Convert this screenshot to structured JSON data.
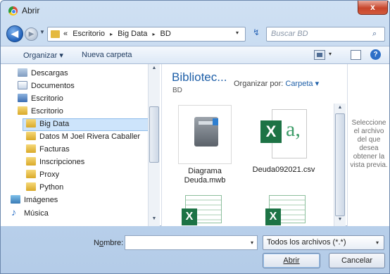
{
  "window": {
    "title": "Abrir",
    "close_glyph": "x"
  },
  "nav": {
    "back_glyph": "◀",
    "forward_glyph": "▶",
    "history_glyph": "▼",
    "breadcrumb_lead": "«",
    "breadcrumb_sep": "▸",
    "breadcrumb": [
      "Escritorio",
      "Big Data",
      "BD"
    ],
    "dropdown_glyph": "▾",
    "refresh_glyph": "↯",
    "search_placeholder": "Buscar BD",
    "search_glyph": "⌕"
  },
  "toolbar": {
    "organize": "Organizar ▾",
    "new_folder": "Nueva carpeta",
    "view_drop": "▾",
    "help": "?"
  },
  "sidebar": {
    "items": [
      {
        "label": "Descargas",
        "icon": "download-icon"
      },
      {
        "label": "Documentos",
        "icon": "documents-icon"
      },
      {
        "label": "Escritorio",
        "icon": "desktop-icon"
      },
      {
        "label": "Escritorio",
        "icon": "folder-icon"
      },
      {
        "label": "Big Data",
        "icon": "folder-icon",
        "selected": true
      },
      {
        "label": "Datos M Joel Rivera Caballer",
        "icon": "folder-icon"
      },
      {
        "label": "Facturas",
        "icon": "folder-icon"
      },
      {
        "label": "Inscripciones",
        "icon": "folder-icon"
      },
      {
        "label": "Proxy",
        "icon": "folder-icon"
      },
      {
        "label": "Python",
        "icon": "folder-icon"
      },
      {
        "label": "Imágenes",
        "icon": "images-icon"
      },
      {
        "label": "Música",
        "icon": "music-icon"
      }
    ]
  },
  "library": {
    "title": "Bibliotec...",
    "subtitle": "BD",
    "arrange_label": "Organizar por:",
    "arrange_value": "Carpeta ▾"
  },
  "files": [
    {
      "name_line1": "Diagrama",
      "name_line2": "Deuda.mwb",
      "type": "mwb"
    },
    {
      "name_line1": "Deuda092021.csv",
      "name_line2": "",
      "type": "csv"
    }
  ],
  "preview": {
    "text": "Seleccione el archivo del que desea obtener la vista previa."
  },
  "bottom": {
    "name_label_pre": "N",
    "name_label_underline": "o",
    "name_label_post": "mbre:",
    "name_value": "",
    "filter_value": "Todos los archivos (*.*)",
    "filter_drop": "▾",
    "open_button": "Abrir",
    "cancel_button": "Cancelar"
  },
  "colors": {
    "accent": "#1e5fa8",
    "selection": "#cde4fb",
    "excel_green": "#1d7345"
  }
}
